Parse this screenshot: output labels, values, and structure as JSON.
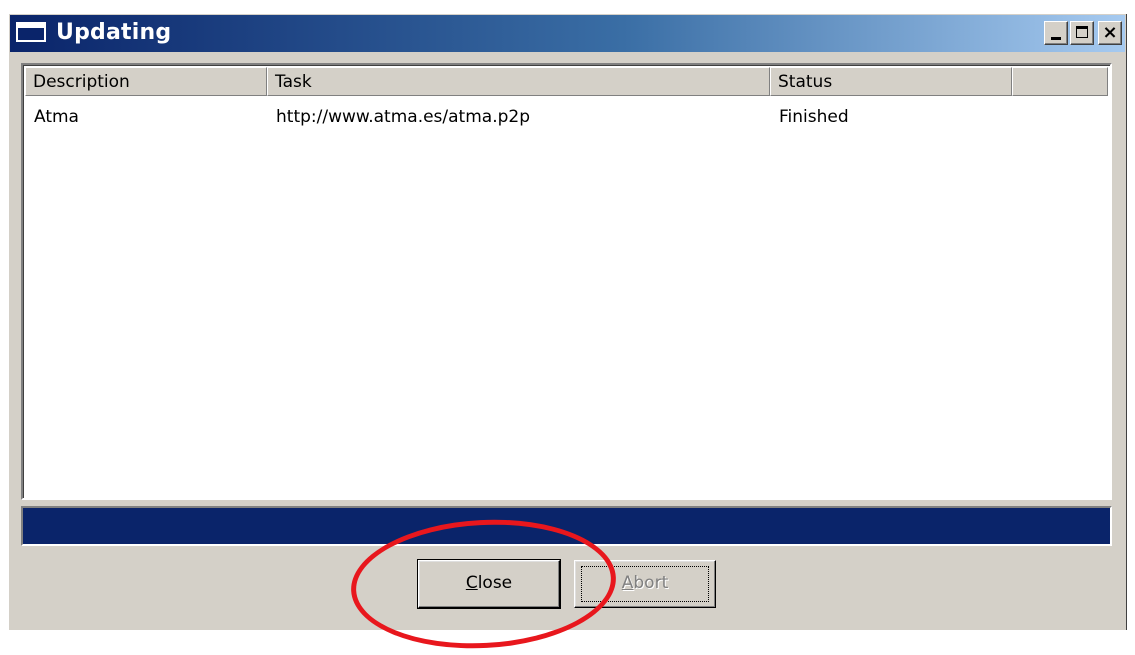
{
  "window": {
    "title": "Updating",
    "controls": {
      "minimize_icon": "minimize-icon",
      "maximize_icon": "maximize-icon",
      "close_icon": "close-icon",
      "close_glyph": "×"
    }
  },
  "list": {
    "columns": [
      "Description",
      "Task",
      "Status",
      ""
    ],
    "rows": [
      {
        "description": "Atma",
        "task": "http://www.atma.es/atma.p2p",
        "status": "Finished"
      }
    ]
  },
  "progress": {
    "fraction": 1.0,
    "color": "#0a246a"
  },
  "buttons": {
    "close": {
      "mnemonic": "C",
      "rest": "lose",
      "enabled": true
    },
    "abort": {
      "mnemonic": "A",
      "rest": "bort",
      "enabled": false
    }
  },
  "annotation": {
    "color": "#e8171d",
    "shape": "ellipse",
    "target": "close-button"
  }
}
